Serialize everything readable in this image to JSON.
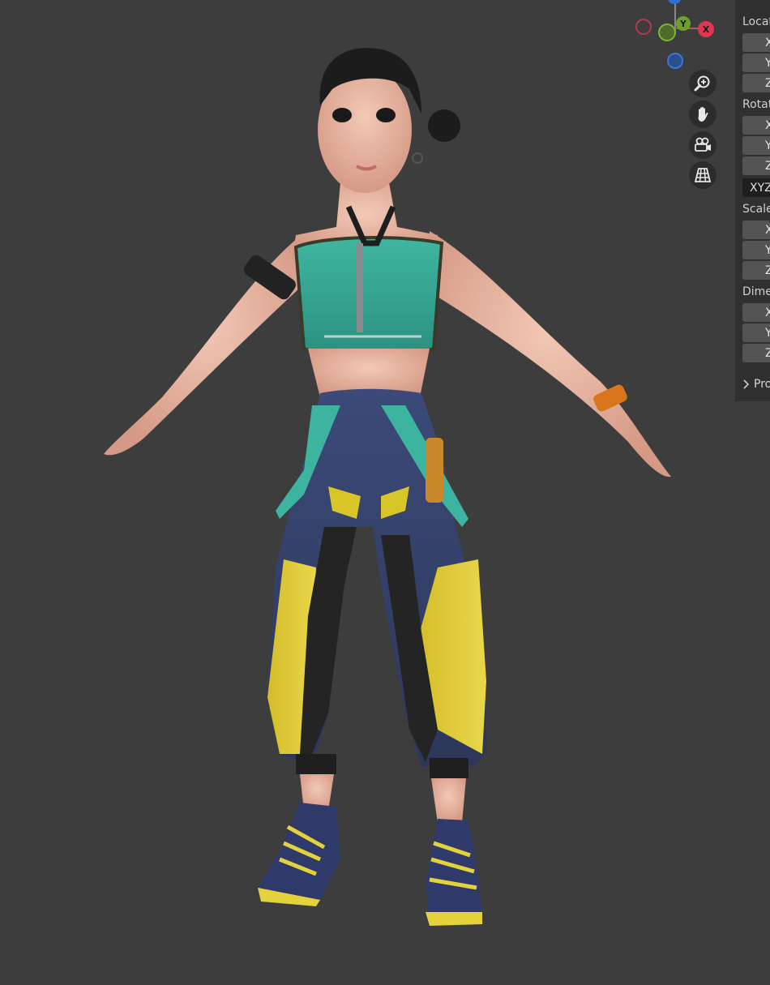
{
  "viewport": {
    "background": "#3d3d3d",
    "object": "stylized character model in T-pose"
  },
  "gizmo": {
    "x_label": "X",
    "y_label": "Y",
    "colors": {
      "x": "#e0364f",
      "y": "#6ea12a",
      "z": "#2f6fd1",
      "neg_x": "#8a2e3b",
      "neg_y": "#4e6f22",
      "neg_z": "#27538f"
    }
  },
  "nav_buttons": [
    {
      "name": "zoom-icon"
    },
    {
      "name": "hand-pan-icon"
    },
    {
      "name": "camera-icon"
    },
    {
      "name": "grid-perspective-icon"
    }
  ],
  "properties": {
    "location_label": "Locat",
    "rotation_label": "Rotat",
    "scale_label": "Scale",
    "dimensions_label": "Dime",
    "axes": [
      "X",
      "Y",
      "Z"
    ],
    "rotation_mode": "XYZ",
    "collapsed_section": "Pro"
  }
}
